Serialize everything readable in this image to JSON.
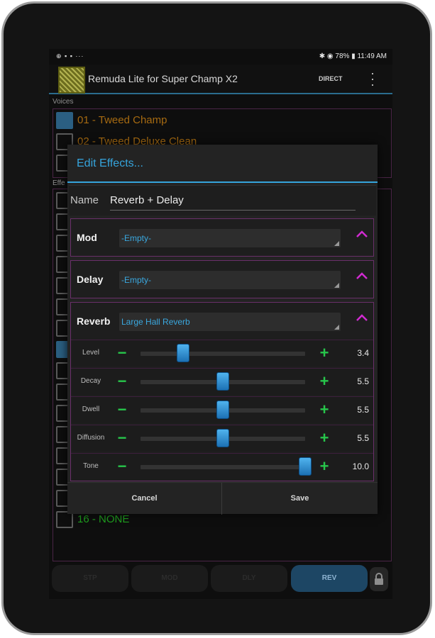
{
  "status": {
    "left_icons": "⊕ ▪ ▪ ···",
    "right_text": "✱ ◉ 78% ▮ 11:49 AM"
  },
  "app": {
    "title": "Remuda Lite for Super Champ X2",
    "direct_label": "DIRECT",
    "overflow_icon": "more-vert-icon"
  },
  "voices": {
    "section_label": "Voices",
    "items": [
      {
        "label": "01 - Tweed Champ",
        "checked": true
      },
      {
        "label": "02 - Tweed Deluxe Clean",
        "checked": false
      },
      {
        "label": "",
        "checked": false
      }
    ]
  },
  "effects": {
    "section_label": "Effe",
    "last_item_label": "16 - NONE"
  },
  "bottom_bar": {
    "buttons": [
      "STP",
      "MOD",
      "DLY",
      "REV"
    ],
    "active": "REV",
    "lock_icon": "lock-icon"
  },
  "dialog": {
    "title": "Edit Effects...",
    "name_label": "Name",
    "name_value": "Reverb + Delay",
    "mod": {
      "label": "Mod",
      "value": "-Empty-"
    },
    "delay": {
      "label": "Delay",
      "value": "-Empty-"
    },
    "reverb": {
      "label": "Reverb",
      "value": "Large Hall Reverb",
      "params": [
        {
          "label": "Level",
          "value": "3.4",
          "fraction": 0.26
        },
        {
          "label": "Decay",
          "value": "5.5",
          "fraction": 0.5
        },
        {
          "label": "Dwell",
          "value": "5.5",
          "fraction": 0.5
        },
        {
          "label": "Diffusion",
          "value": "5.5",
          "fraction": 0.5
        },
        {
          "label": "Tone",
          "value": "10.0",
          "fraction": 1.0
        }
      ]
    },
    "cancel_label": "Cancel",
    "save_label": "Save"
  },
  "colors": {
    "accent_blue": "#35a4dc",
    "section_border": "#6a2f6a",
    "plus_minus": "#27c64b",
    "collapse": "#d12ad1"
  }
}
